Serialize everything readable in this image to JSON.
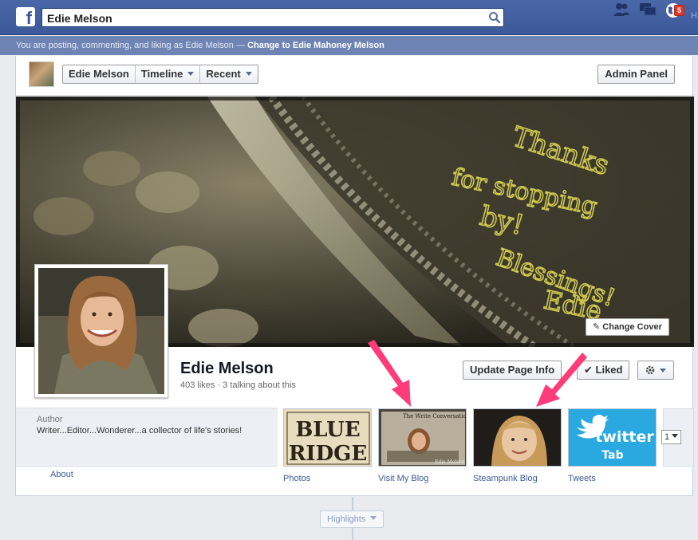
{
  "search": {
    "value": "Edie Melson"
  },
  "notifications": {
    "count": "5"
  },
  "topbar": {
    "more_text": "H"
  },
  "acting_bar": {
    "text": "You are posting, commenting, and liking as Edie Melson — ",
    "switch_link": "Change to Edie Mahoney Melson"
  },
  "page_nav": {
    "items": [
      {
        "label": "Edie Melson",
        "has_caret": false
      },
      {
        "label": "Timeline",
        "has_caret": true
      },
      {
        "label": "Recent",
        "has_caret": true
      }
    ],
    "admin_label": "Admin Panel"
  },
  "cover": {
    "change_label": "Change Cover"
  },
  "page": {
    "name": "Edie Melson",
    "stats": "403 likes · 3 talking about this",
    "update_label": "Update Page Info",
    "liked_label": "Liked"
  },
  "about": {
    "category": "Author",
    "description": "Writer...Editor...Wonderer...a collector of life's stories!",
    "link": "About"
  },
  "apps": [
    {
      "label": "Photos"
    },
    {
      "label": "Visit My Blog"
    },
    {
      "label": "Steampunk Blog"
    },
    {
      "label": "Tweets"
    }
  ],
  "app_tiles": {
    "blue_ridge": "BLUE",
    "blue_ridge2": "RIDGE",
    "blog_title": "The Write Conversation",
    "blog_credit": "Edie Melson",
    "twitter_word": "twitter",
    "twitter_sub": "Tab"
  },
  "apps_more_count": "1",
  "highlights_label": "Highlights",
  "cover_signature": {
    "line1": "Thanks",
    "line2": "for stopping",
    "line3": "by!",
    "line4": "Blessings!",
    "line5": "Edie"
  },
  "colors": {
    "brand": "#3b5998",
    "arrow": "#ff3b7a"
  }
}
